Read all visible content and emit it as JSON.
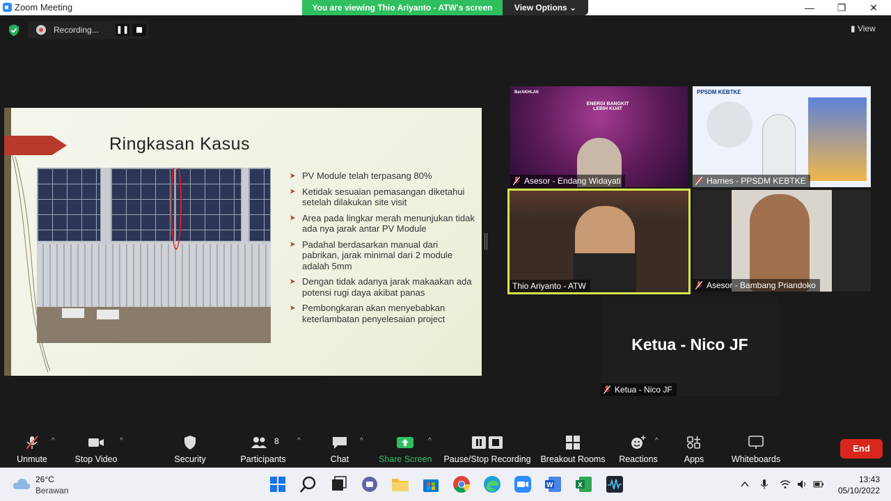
{
  "window": {
    "title": "Zoom Meeting",
    "banner": "You are viewing Thio Ariyanto - ATW's screen",
    "view_options": "View Options ⌄",
    "minimize": "—",
    "restore": "❐",
    "close": "✕"
  },
  "meeting_bar": {
    "recording_label": "Recording...",
    "pause_glyph": "❚❚",
    "view_label": "View"
  },
  "slide": {
    "title": "Ringkasan Kasus",
    "bullets": [
      "PV Module telah terpasang 80%",
      "Ketidak sesuaian pemasangan diketahui setelah dilakukan site visit",
      "Area pada lingkar merah menunjukan tidak ada nya jarak antar PV Module",
      "Padahal berdasarkan manual dari pabrikan, jarak minimal dari 2 module adalah 5mm",
      "Dengan tidak adanya jarak makaakan ada potensi rugi daya akibat panas",
      "Pembongkaran akan menyebabkan keterlambatan penyelesaian project"
    ]
  },
  "participants": [
    {
      "name": "Asesor - Endang Widayati",
      "muted": true
    },
    {
      "name": "Harries - PPSDM KEBTKE",
      "muted": true
    },
    {
      "name": "Thio Ariyanto - ATW",
      "muted": false,
      "active_speaker": true
    },
    {
      "name": "Asesor - Bambang Priandoko",
      "muted": true
    },
    {
      "name": "Ketua - Nico JF",
      "muted": true,
      "display_label": "Ketua - Nico JF"
    }
  ],
  "tile_text": {
    "t1_brand": "BerAKHLAK",
    "t1_headline": "ENERGI BANGKIT LEBIH KUAT",
    "t2_brand": "PPSDM KEBTKE"
  },
  "toolbar": {
    "unmute": "Unmute",
    "stop_video": "Stop Video",
    "security": "Security",
    "participants": "Participants",
    "participants_count": "8",
    "chat": "Chat",
    "share_screen": "Share Screen",
    "pause_stop_recording": "Pause/Stop Recording",
    "breakout_rooms": "Breakout Rooms",
    "reactions": "Reactions",
    "apps": "Apps",
    "whiteboards": "Whiteboards",
    "end": "End",
    "caret": "^"
  },
  "taskbar": {
    "temperature": "26°C",
    "weather": "Berawan",
    "time": "13:43",
    "date": "05/10/2022"
  },
  "colors": {
    "share_green": "#2fbf5f",
    "end_red": "#d9261c",
    "active_speaker": "#d6e64a",
    "slide_accent": "#b8392a"
  }
}
